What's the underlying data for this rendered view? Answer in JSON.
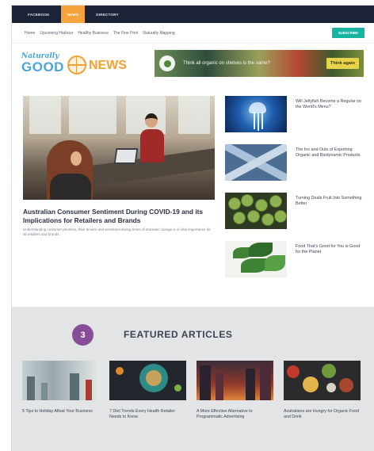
{
  "topnav": {
    "tabs": [
      {
        "label": "FACEBOOK",
        "active": false
      },
      {
        "label": "NEWS",
        "active": true
      },
      {
        "label": "DIRECTORY",
        "active": false
      }
    ]
  },
  "subnav": {
    "links": [
      "Home",
      "Upcoming Harbour",
      "Healthy Business",
      "The Fine Print",
      "Naturally Mapping"
    ],
    "subscribe_label": "SUBSCRIBE"
  },
  "logo": {
    "line1": "Naturally",
    "line2": "GOOD",
    "line3": "NEWS"
  },
  "ad": {
    "text": "Think all organic on shelves is the same?",
    "button_label": "Think again"
  },
  "lead": {
    "title": "Australian Consumer Sentiment During COVID-19 and its Implications for Retailers and Brands",
    "description": "Understanding customer priorities, their drivers and sentiment during times of dramatic change is of vital importance for all retailers and brands."
  },
  "side_articles": [
    {
      "title": "Will Jellyfish Become a Regular on the World's Menu?",
      "thumb": "jellyfish"
    },
    {
      "title": "The Ins and Outs of Exporting Organic and Biodynamic Products",
      "thumb": "crossing"
    },
    {
      "title": "Turning Deals Fruit Into Something Better",
      "thumb": "sprouts"
    },
    {
      "title": "Food That's Good for You is Good for the Planet",
      "thumb": "leaves"
    }
  ],
  "featured": {
    "step_number": "3",
    "heading": "FEATURED ARTICLES",
    "cards": [
      {
        "title": "5 Tips to Holiday Afloat Your Business"
      },
      {
        "title": "7 Diet Trends Every Health Retailer Needs to Know"
      },
      {
        "title": "A More Effective Alternative to Programmatic Advertising"
      },
      {
        "title": "Australians are Hungry for Organic Food and Drink"
      }
    ]
  },
  "colors": {
    "nav_bg": "#1d2336",
    "nav_active": "#f4a43a",
    "subscribe": "#19b3a2",
    "step_badge": "#874d98",
    "featured_bg": "#e3e4e6"
  }
}
